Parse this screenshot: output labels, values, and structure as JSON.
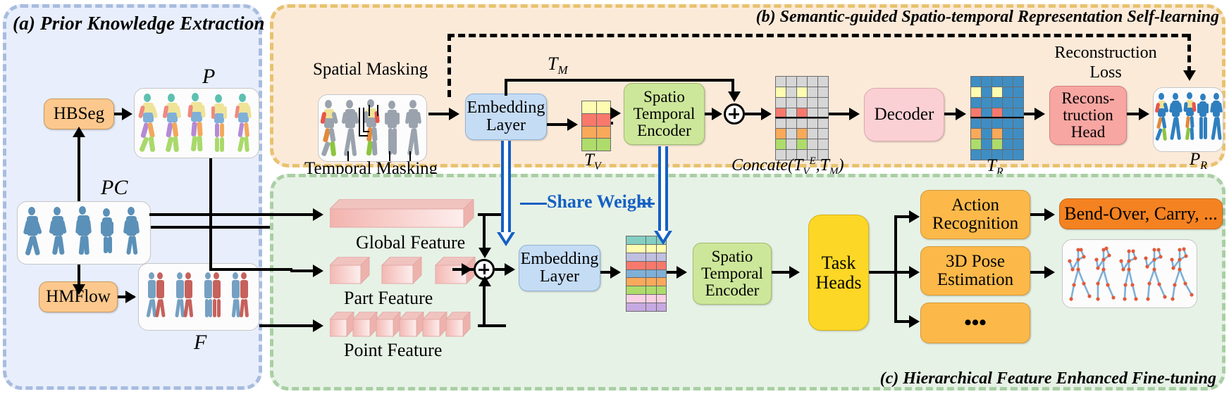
{
  "figure": {
    "type": "diagram",
    "caption_free": true
  },
  "panels": {
    "a": {
      "title": "(a) Prior Knowledge Extraction"
    },
    "b": {
      "title": "(b) Semantic-guided Spatio-temporal Representation Self-learning"
    },
    "c": {
      "title": "(c) Hierarchical Feature Enhanced Fine-tuning"
    }
  },
  "panel_a": {
    "hbseg_label": "HBSeg",
    "hmflow_label": "HMFlow",
    "pc_label": "PC",
    "p_label": "P",
    "f_label": "F"
  },
  "panel_b": {
    "spatial_masking_label": "Spatial Masking",
    "temporal_masking_label": "Temporal Masking",
    "embedding_layer_label": "Embedding\nLayer",
    "embedding_line1": "Embedding",
    "embedding_line2": "Layer",
    "tv_label": "T_V",
    "tm_label": "T_M",
    "encoder_line1": "Spatio",
    "encoder_line2": "Temporal",
    "encoder_line3": "Encoder",
    "concate_label": "Concate(T_V^E , T_M)",
    "decoder_label": "Decoder",
    "tr_label": "T_R",
    "recon_head_line1": "Recons-",
    "recon_head_line2": "truction",
    "recon_head_line3": "Head",
    "recon_loss_line1": "Reconstruction",
    "recon_loss_line2": "Loss",
    "pr_label": "P_R"
  },
  "panel_c": {
    "global_feature_label": "Global Feature",
    "part_feature_label": "Part Feature",
    "point_feature_label": "Point Feature",
    "embedding_line1": "Embedding",
    "embedding_line2": "Layer",
    "encoder_line1": "Spatio",
    "encoder_line2": "Temporal",
    "encoder_line3": "Encoder",
    "task_heads_line1": "Task",
    "task_heads_line2": "Heads",
    "heads": [
      {
        "line1": "Action",
        "line2": "Recognition"
      },
      {
        "line1": "3D Pose",
        "line2": "Estimation"
      },
      {
        "line1": "•••",
        "line2": ""
      }
    ],
    "action_result": "Bend-Over,  Carry, ...",
    "share_weight_label": "Share Weight"
  },
  "colors": {
    "panel_a_fill": "#e8eefb",
    "panel_a_border": "#a8bcdf",
    "panel_b_fill": "#fcead9",
    "panel_b_border": "#e7c370",
    "panel_c_fill": "#e7f2e6",
    "panel_c_border": "#a9cfa4",
    "orange_box": "#fcc88d",
    "blue_box": "#c5dcf5",
    "green_box": "#cde79a",
    "pink_box": "#fbd0d4",
    "salmon_box": "#f8a6a2",
    "yellow_box": "#fcd725",
    "amber_box": "#fcb94a",
    "deep_orange_box": "#f58220",
    "share_weight_blue": "#1560c4",
    "token_teal": "#84cfc2",
    "token_yellow": "#fdfcb0",
    "token_lavender": "#bfbfe0",
    "token_red": "#f8796c",
    "token_blue": "#7fb0d8",
    "token_orange": "#f9a95a",
    "token_green": "#aedc6b",
    "token_pink": "#f9cfe4",
    "grid_gray": "#d6d6d6",
    "tr_blue": "#3e8ec4"
  },
  "token_strips": {
    "tv": [
      "#fdfcb0",
      "#f8796c",
      "#f9a95a",
      "#aedc6b"
    ],
    "concate_highlights": {
      "rows": 8,
      "cols": 5,
      "cells": [
        {
          "r": 1,
          "c": 0,
          "color": "#fdfcb0"
        },
        {
          "r": 1,
          "c": 2,
          "color": "#fdfcb0"
        },
        {
          "r": 3,
          "c": 0,
          "color": "#f8796c"
        },
        {
          "r": 3,
          "c": 2,
          "color": "#f8796c"
        },
        {
          "r": 5,
          "c": 0,
          "color": "#f9a95a"
        },
        {
          "r": 5,
          "c": 2,
          "color": "#f9a95a"
        },
        {
          "r": 6,
          "c": 0,
          "color": "#aedc6b"
        },
        {
          "r": 6,
          "c": 2,
          "color": "#aedc6b"
        }
      ]
    },
    "tr_highlights": {
      "rows": 8,
      "cols": 5,
      "base": "#3e8ec4",
      "cells": [
        {
          "r": 1,
          "c": 0,
          "color": "#fdfcb0"
        },
        {
          "r": 1,
          "c": 2,
          "color": "#fdfcb0"
        },
        {
          "r": 3,
          "c": 0,
          "color": "#f8796c"
        },
        {
          "r": 3,
          "c": 2,
          "color": "#f8796c"
        },
        {
          "r": 5,
          "c": 0,
          "color": "#f9a95a"
        },
        {
          "r": 5,
          "c": 2,
          "color": "#f9a95a"
        },
        {
          "r": 6,
          "c": 0,
          "color": "#aedc6b"
        },
        {
          "r": 6,
          "c": 2,
          "color": "#aedc6b"
        }
      ]
    },
    "finetune": [
      "#84cfc2",
      "#fdfcb0",
      "#bfbfe0",
      "#f8796c",
      "#7fb0d8",
      "#f9a95a",
      "#aedc6b",
      "#f9cfe4",
      "#c6a9e0"
    ]
  }
}
